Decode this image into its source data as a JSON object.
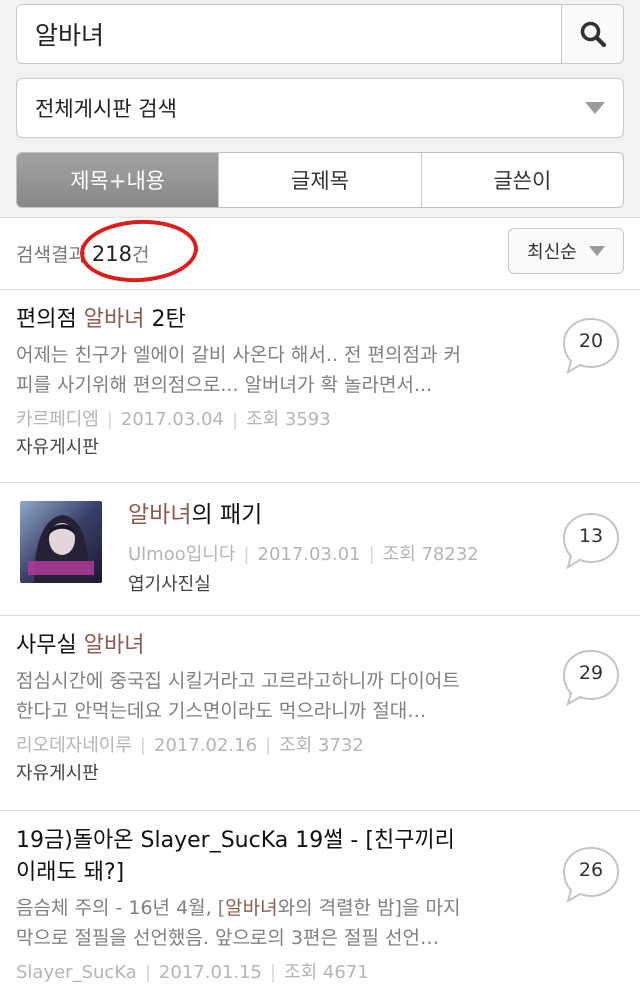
{
  "search": {
    "value": "알바녀",
    "icon": "search-icon"
  },
  "board_select": {
    "label": "전체게시판 검색",
    "icon": "dropdown-triangle-icon"
  },
  "tabs": [
    {
      "label": "제목+내용",
      "active": true
    },
    {
      "label": "글제목",
      "active": false
    },
    {
      "label": "글쓴이",
      "active": false
    }
  ],
  "results": {
    "label": "검색결과",
    "count": "218",
    "unit": "건",
    "annotation_color": "#e21a1a"
  },
  "sort": {
    "label": "최신순"
  },
  "highlight_color": "#8d5a52",
  "posts": [
    {
      "title_before": "편의점 ",
      "title_highlight": "알바녀",
      "title_after": " 2탄",
      "snippet_1": "어제는 친구가 엘에이 갈비 사온다 해서.. 전 편의점과 커",
      "snippet_2": "피를 사기위해 편의점으로... 알버녀가 확 놀라면서...",
      "author": "카르페디엠",
      "date": "2017.03.04",
      "views": "조회 3593",
      "board": "자유게시판",
      "comments": "20"
    },
    {
      "title_before": "",
      "title_highlight": "알바녀",
      "title_after": "의 패기",
      "author": "Ulmoo입니다",
      "date": "2017.03.01",
      "views": "조회 78232",
      "board": "엽기사진실",
      "comments": "13",
      "thumbnail_text": "Ulmoo입니다"
    },
    {
      "title_before": "사무실 ",
      "title_highlight": "알바녀",
      "title_after": "",
      "snippet_1": "점심시간에 중국집 시킬거라고 고르라고하니까 다이어트",
      "snippet_2": "한다고 안먹는데요 기스면이라도 먹으라니까 절대…",
      "author": "리오데자네이루",
      "date": "2017.02.16",
      "views": "조회 3732",
      "board": "자유게시판",
      "comments": "29"
    },
    {
      "title_line1": "19금)돌아온 Slayer_SucKa 19썰 - [친구끼리",
      "title_line2": "이래도 돼?]",
      "snippet_1_before": "음슴체 주의 - 16년 4월, [",
      "snippet_1_highlight": "알바녀",
      "snippet_1_after": "와의 격렬한 밤]을 마지",
      "snippet_2": "막으로 절필을 선언했음. 앞으로의 3편은 절필 선언…",
      "author": "Slayer_SucKa",
      "date": "2017.01.15",
      "views": "조회 4671",
      "comments": "26"
    }
  ]
}
